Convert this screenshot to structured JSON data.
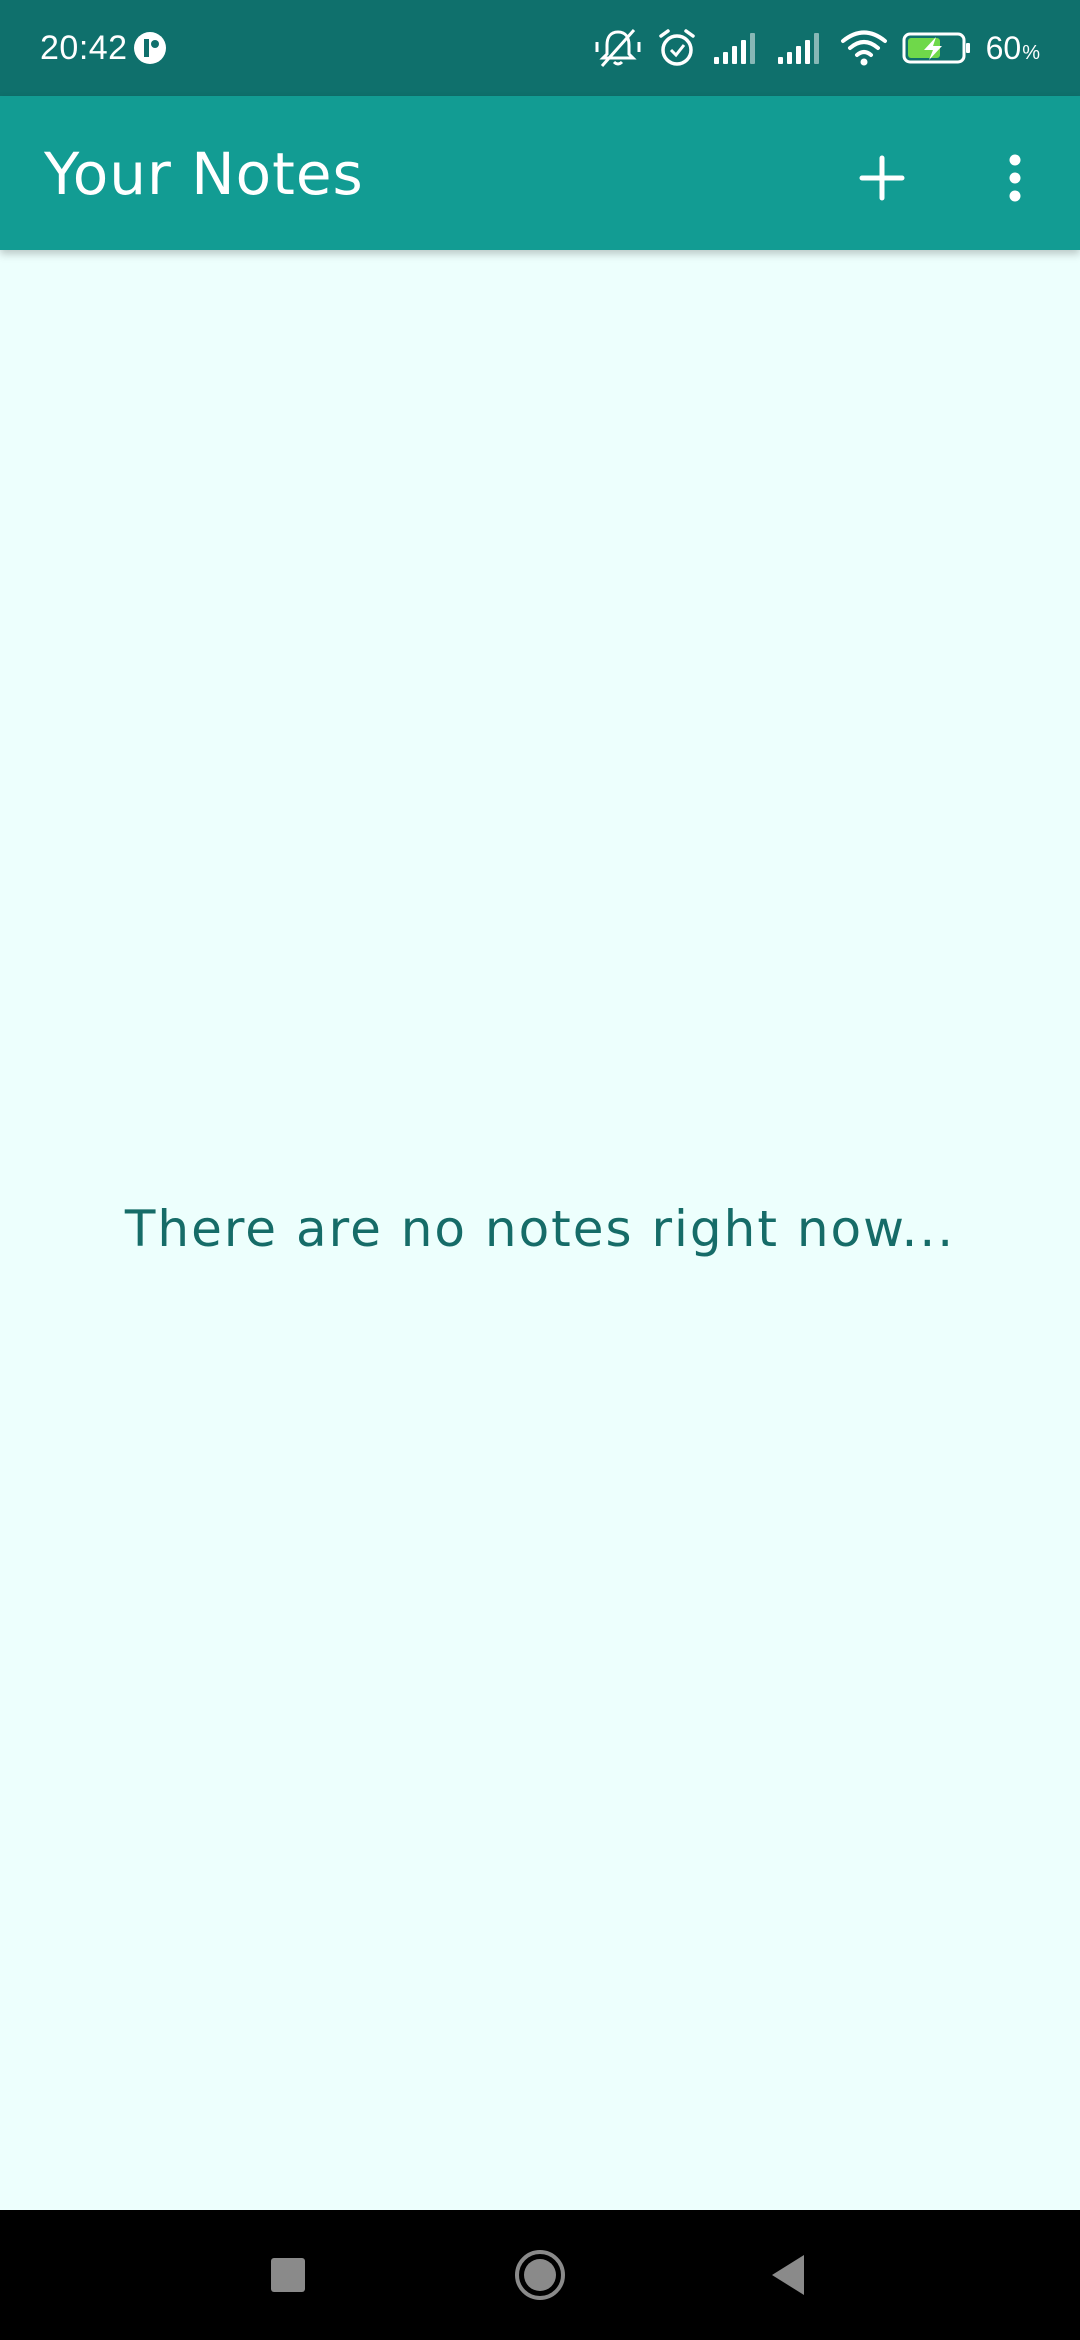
{
  "status_bar": {
    "time": "20:42",
    "battery_percent": "60",
    "battery_percent_symbol": "%",
    "icons": [
      "app-notification-icon",
      "silent-bell-icon",
      "alarm-icon",
      "signal-icon",
      "signal-icon",
      "wifi-icon",
      "battery-charging-icon"
    ]
  },
  "app_bar": {
    "title": "Your Notes",
    "add_icon": "plus-icon",
    "menu_icon": "more-vert-icon"
  },
  "content": {
    "empty_message": "There are no notes right now..."
  },
  "nav_bar": {
    "buttons": [
      "recents-icon",
      "home-icon",
      "back-icon"
    ]
  },
  "colors": {
    "status_bar": "#0f706c",
    "app_bar": "#129c93",
    "background": "#edfffd",
    "empty_text": "#166c68",
    "nav_bar": "#000000",
    "battery_charge": "#6fd84a"
  }
}
